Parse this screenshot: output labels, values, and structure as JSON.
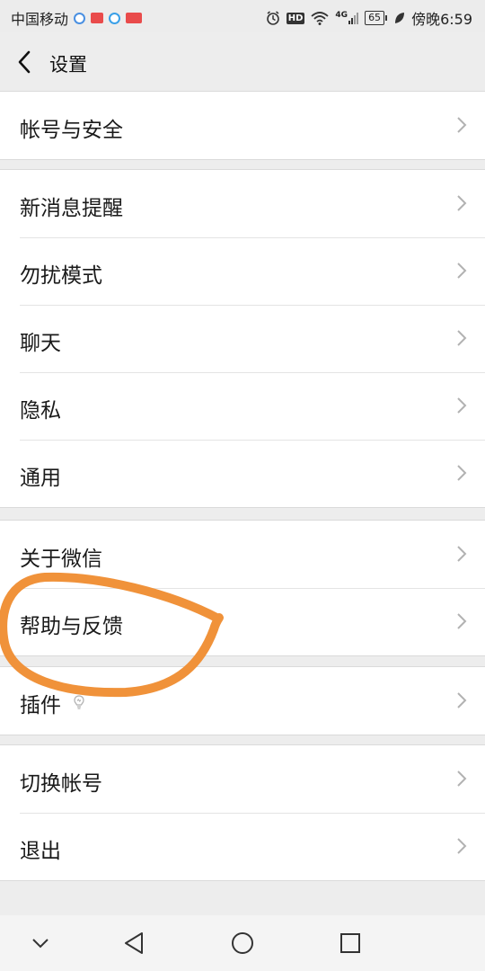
{
  "status_bar": {
    "carrier": "中国移动",
    "app_badges": [
      {
        "name": "browser-app",
        "color": "#4a90e2"
      },
      {
        "name": "news-app",
        "color": "#e94b4b"
      },
      {
        "name": "search-app",
        "color": "#3aa0e8"
      },
      {
        "name": "toutiao-app",
        "color": "#e94b4b"
      }
    ],
    "hd_label": "HD",
    "network_label": "4G",
    "battery_level": "65",
    "time": "傍晚6:59"
  },
  "nav": {
    "title": "设置"
  },
  "settings": {
    "group1": [
      {
        "label": "帐号与安全"
      }
    ],
    "group2": [
      {
        "label": "新消息提醒"
      },
      {
        "label": "勿扰模式"
      },
      {
        "label": "聊天"
      },
      {
        "label": "隐私"
      },
      {
        "label": "通用"
      }
    ],
    "group3": [
      {
        "label": "关于微信"
      },
      {
        "label": "帮助与反馈"
      }
    ],
    "group4": [
      {
        "label": "插件"
      }
    ],
    "group5": [
      {
        "label": "切换帐号"
      },
      {
        "label": "退出"
      }
    ]
  },
  "colors": {
    "background": "#ededed",
    "annotation": "#f0923a",
    "chevron": "#b2b2b2"
  }
}
